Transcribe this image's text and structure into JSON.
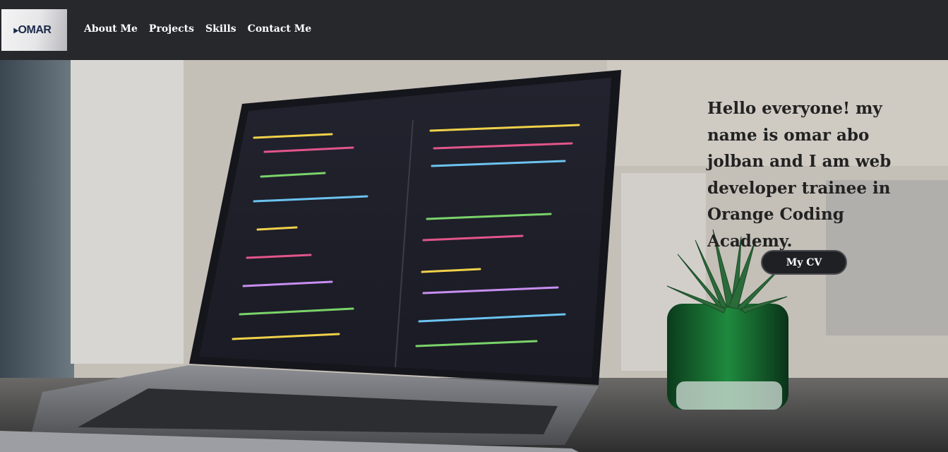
{
  "logo": {
    "text": "OMAR",
    "icon": "omar-logo-mark"
  },
  "nav": {
    "items": [
      {
        "label": "About Me"
      },
      {
        "label": "Projects"
      },
      {
        "label": "Skills"
      },
      {
        "label": "Contact Me"
      }
    ]
  },
  "hero": {
    "intro": "Hello everyone! my name is omar abo jolban and I am web developer trainee in Orange Coding Academy.",
    "cv_button": "My CV",
    "background": "laptop-with-code-and-plant-photo"
  },
  "colors": {
    "navbar": "#27282c",
    "button": "#1f2024",
    "text_dark": "#222222"
  }
}
